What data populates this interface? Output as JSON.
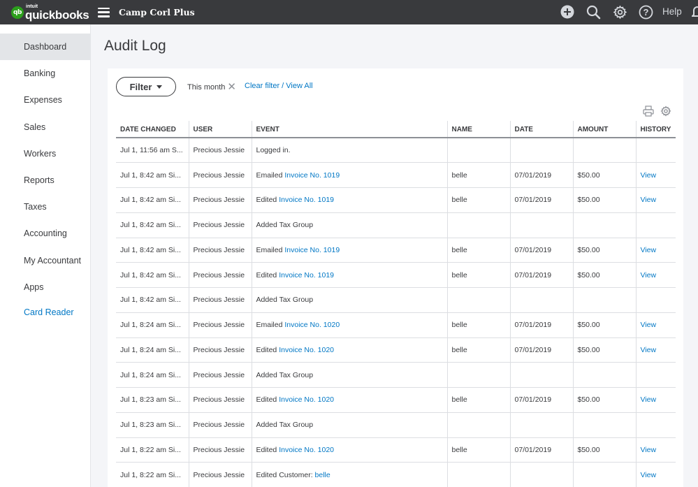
{
  "topbar": {
    "logo_intuit": "intuit",
    "logo_name": "quickbooks",
    "logo_badge": "qb",
    "company": "Camp Corl Plus",
    "help_label": "Help",
    "icons": [
      "plus-icon",
      "search-icon",
      "gear-icon",
      "help-icon",
      "bell-icon"
    ]
  },
  "sidebar": {
    "items": [
      {
        "label": "Dashboard"
      },
      {
        "label": "Banking"
      },
      {
        "label": "Expenses"
      },
      {
        "label": "Sales"
      },
      {
        "label": "Workers"
      },
      {
        "label": "Reports"
      },
      {
        "label": "Taxes"
      },
      {
        "label": "Accounting"
      },
      {
        "label": "My Accountant"
      },
      {
        "label": "Apps"
      },
      {
        "label": "Card Reader"
      }
    ],
    "active": "Dashboard"
  },
  "page": {
    "title": "Audit Log",
    "filter_label": "Filter",
    "active_filter": "This month",
    "clear_filter": "Clear filter / View All"
  },
  "table": {
    "headers": [
      "DATE CHANGED",
      "USER",
      "EVENT",
      "NAME",
      "DATE",
      "AMOUNT",
      "HISTORY"
    ],
    "rows": [
      {
        "date_changed": "Jul 1, 11:56 am S...",
        "user": "Precious Jessie",
        "event_prefix": "Logged in.",
        "event_link": "",
        "name": "",
        "date": "",
        "amount": "",
        "history": ""
      },
      {
        "date_changed": "Jul 1, 8:42 am Si...",
        "user": "Precious Jessie",
        "event_prefix": "Emailed ",
        "event_link": "Invoice No. 1019",
        "name": "belle",
        "date": "07/01/2019",
        "amount": "$50.00",
        "history": "View"
      },
      {
        "date_changed": "Jul 1, 8:42 am Si...",
        "user": "Precious Jessie",
        "event_prefix": "Edited ",
        "event_link": "Invoice No. 1019",
        "name": "belle",
        "date": "07/01/2019",
        "amount": "$50.00",
        "history": "View"
      },
      {
        "date_changed": "Jul 1, 8:42 am Si...",
        "user": "Precious Jessie",
        "event_prefix": "Added Tax Group",
        "event_link": "",
        "name": "",
        "date": "",
        "amount": "",
        "history": ""
      },
      {
        "date_changed": "Jul 1, 8:42 am Si...",
        "user": "Precious Jessie",
        "event_prefix": "Emailed ",
        "event_link": "Invoice No. 1019",
        "name": "belle",
        "date": "07/01/2019",
        "amount": "$50.00",
        "history": "View"
      },
      {
        "date_changed": "Jul 1, 8:42 am Si...",
        "user": "Precious Jessie",
        "event_prefix": "Edited ",
        "event_link": "Invoice No. 1019",
        "name": "belle",
        "date": "07/01/2019",
        "amount": "$50.00",
        "history": "View"
      },
      {
        "date_changed": "Jul 1, 8:42 am Si...",
        "user": "Precious Jessie",
        "event_prefix": "Added Tax Group",
        "event_link": "",
        "name": "",
        "date": "",
        "amount": "",
        "history": ""
      },
      {
        "date_changed": "Jul 1, 8:24 am Si...",
        "user": "Precious Jessie",
        "event_prefix": "Emailed ",
        "event_link": "Invoice No. 1020",
        "name": "belle",
        "date": "07/01/2019",
        "amount": "$50.00",
        "history": "View"
      },
      {
        "date_changed": "Jul 1, 8:24 am Si...",
        "user": "Precious Jessie",
        "event_prefix": "Edited ",
        "event_link": "Invoice No. 1020",
        "name": "belle",
        "date": "07/01/2019",
        "amount": "$50.00",
        "history": "View"
      },
      {
        "date_changed": "Jul 1, 8:24 am Si...",
        "user": "Precious Jessie",
        "event_prefix": "Added Tax Group",
        "event_link": "",
        "name": "",
        "date": "",
        "amount": "",
        "history": ""
      },
      {
        "date_changed": "Jul 1, 8:23 am Si...",
        "user": "Precious Jessie",
        "event_prefix": "Edited ",
        "event_link": "Invoice No. 1020",
        "name": "belle",
        "date": "07/01/2019",
        "amount": "$50.00",
        "history": "View"
      },
      {
        "date_changed": "Jul 1, 8:23 am Si...",
        "user": "Precious Jessie",
        "event_prefix": "Added Tax Group",
        "event_link": "",
        "name": "",
        "date": "",
        "amount": "",
        "history": ""
      },
      {
        "date_changed": "Jul 1, 8:22 am Si...",
        "user": "Precious Jessie",
        "event_prefix": "Edited ",
        "event_link": "Invoice No. 1020",
        "name": "belle",
        "date": "07/01/2019",
        "amount": "$50.00",
        "history": "View"
      },
      {
        "date_changed": "Jul 1, 8:22 am Si...",
        "user": "Precious Jessie",
        "event_prefix": "Edited Customer: ",
        "event_link": "belle",
        "name": "",
        "date": "",
        "amount": "",
        "history": "View"
      }
    ]
  },
  "colors": {
    "topbar": "#393a3d",
    "brand_green": "#2ca01c",
    "link_blue": "#0077c5",
    "active_nav": "#e3e5e8"
  }
}
